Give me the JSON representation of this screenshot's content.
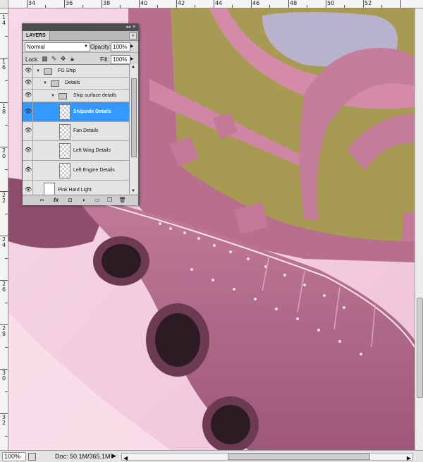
{
  "ruler": {
    "top_labels": [
      "34",
      "36",
      "38",
      "40",
      "42",
      "44",
      "46",
      "48",
      "50",
      "52"
    ],
    "left_labels": [
      "14",
      "16",
      "18",
      "20",
      "22",
      "24",
      "26",
      "28",
      "30",
      "32"
    ]
  },
  "layers_panel": {
    "tab_label": "LAYERS",
    "blend_mode": "Normal",
    "opacity_label": "Opacity:",
    "opacity_value": "100%",
    "lock_label": "Lock:",
    "fill_label": "Fill:",
    "fill_value": "100%",
    "layers": [
      {
        "name": "FG Ship",
        "type": "group"
      },
      {
        "name": "Details",
        "type": "group"
      },
      {
        "name": "Ship surface details",
        "type": "group"
      },
      {
        "name": "Shipside Details",
        "type": "layer",
        "selected": true
      },
      {
        "name": "Fan Details",
        "type": "layer"
      },
      {
        "name": "Left Wing Details",
        "type": "layer"
      },
      {
        "name": "Left Engine Details",
        "type": "layer"
      },
      {
        "name": "Pink Hard Light",
        "type": "layer"
      }
    ],
    "bottom_icons": [
      "link-icon",
      "fx-icon",
      "mask-icon",
      "adjustment-icon",
      "group-icon",
      "new-layer-icon",
      "trash-icon"
    ]
  },
  "status": {
    "zoom": "100%",
    "doc_info": "Doc: 50.1M/365.1M"
  },
  "colors": {
    "selection": "#3399ff",
    "hull_pink": "#b66d8c",
    "deck_olive": "#a79a52",
    "background_pink": "#f3cfe0"
  }
}
